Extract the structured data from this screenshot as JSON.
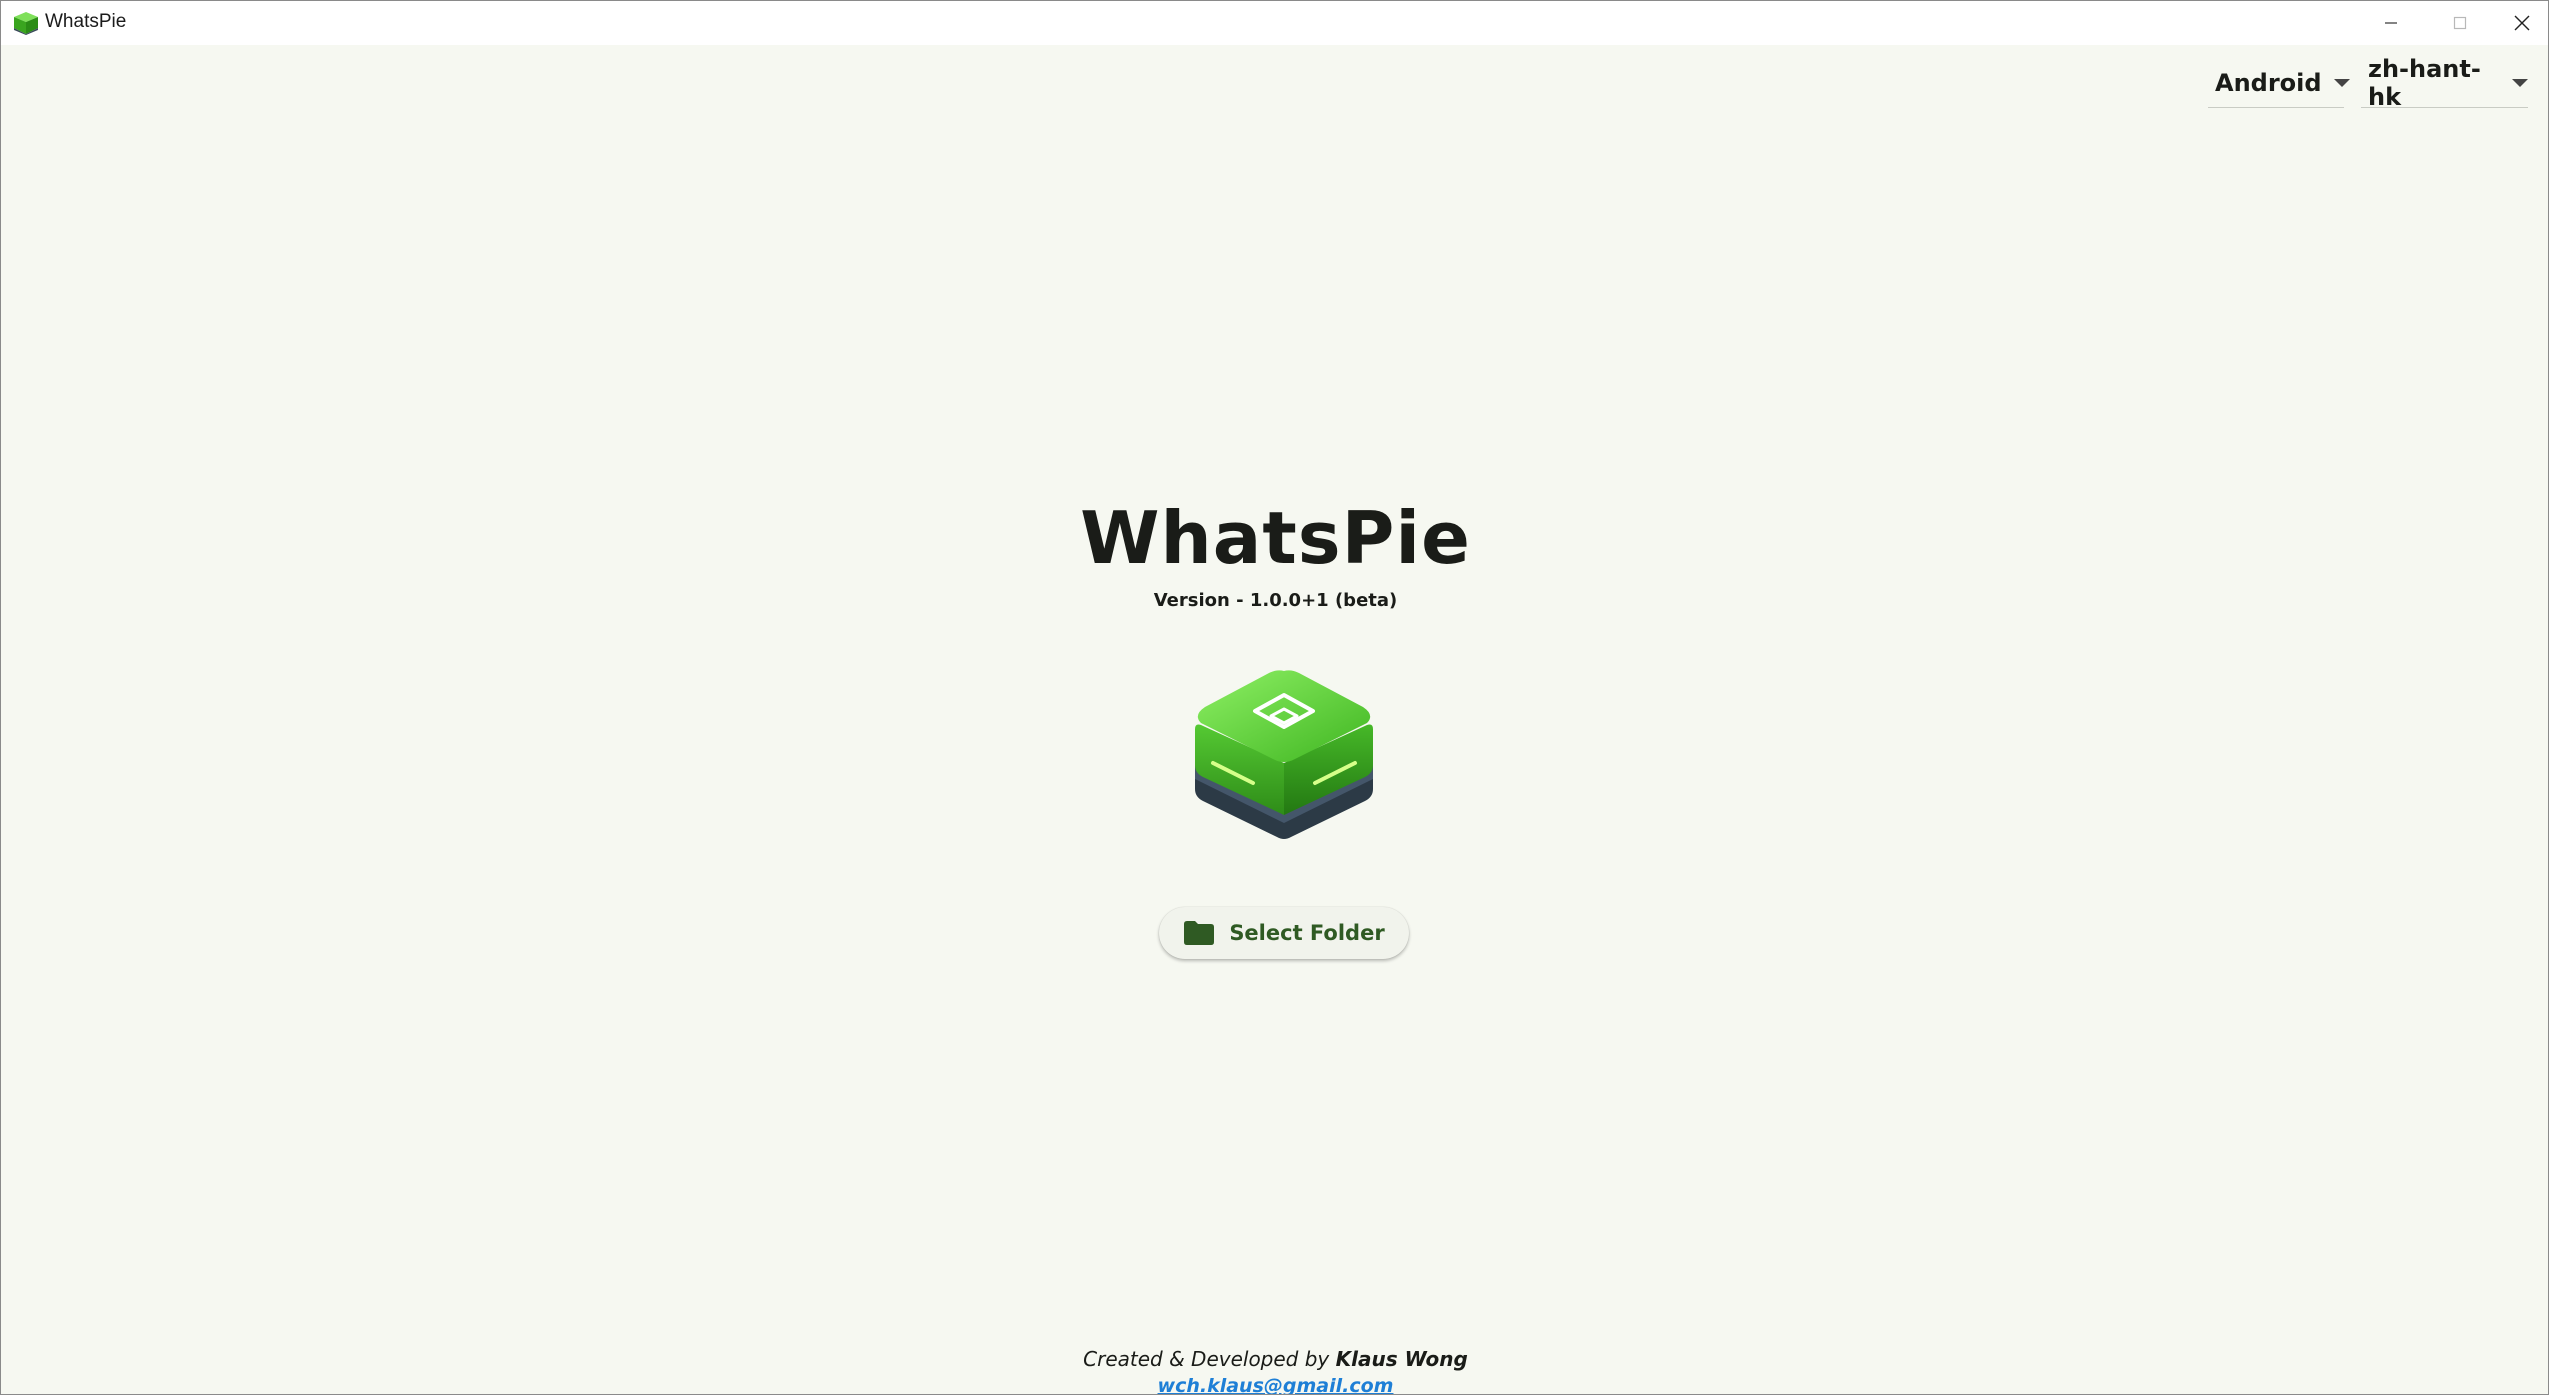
{
  "window": {
    "title": "WhatsPie",
    "icons": {
      "app": "app-cube-icon",
      "minimize": "minimize-icon",
      "maximize": "maximize-icon",
      "close": "close-icon"
    }
  },
  "toolbar": {
    "platform_select": {
      "value": "Android",
      "icon": "chevron-down-icon"
    },
    "language_select": {
      "value": "zh-hant-hk",
      "icon": "chevron-down-icon"
    }
  },
  "main": {
    "title": "WhatsPie",
    "version": "Version - 1.0.0+1 (beta)",
    "logo_icon": "green-cube-logo",
    "select_folder": {
      "label": "Select Folder",
      "icon": "folder-icon"
    }
  },
  "footer": {
    "credit_prefix": "Created & Developed by",
    "author": "Klaus Wong",
    "email": "wch.klaus@gmail.com"
  },
  "colors": {
    "background": "#f6f8f1",
    "accent_green": "#2f5a23",
    "logo_green": "#4fc72c",
    "link_blue": "#1e7fd6"
  }
}
